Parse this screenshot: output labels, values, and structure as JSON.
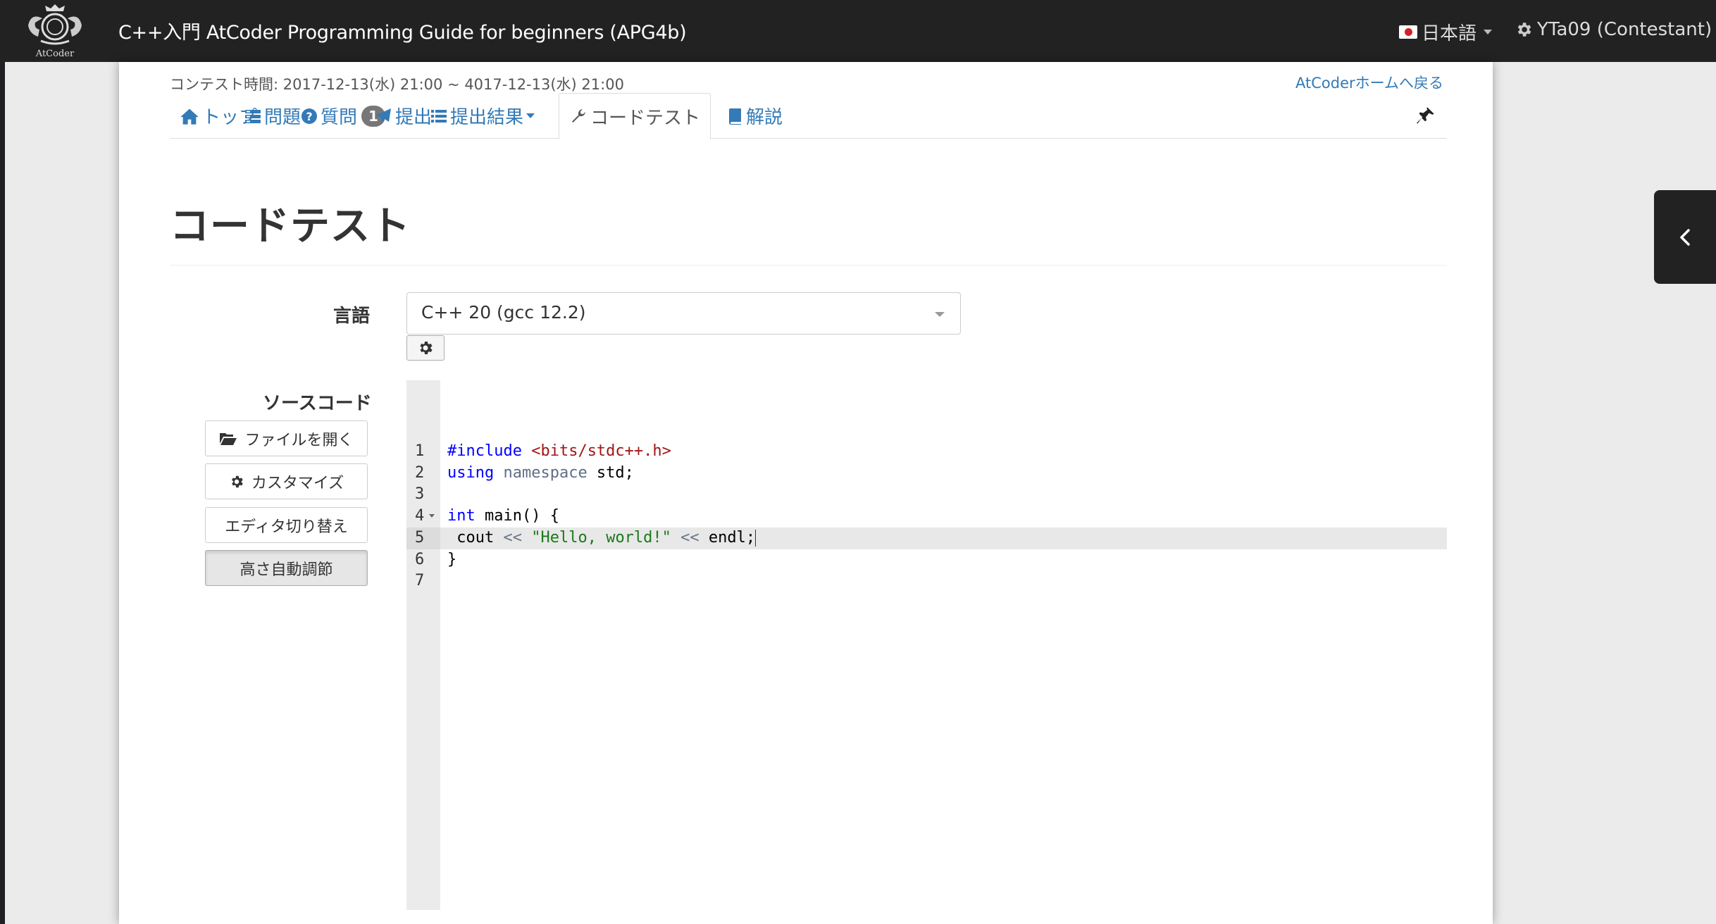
{
  "navbar": {
    "brand": "C++入門 AtCoder Programming Guide for beginners (APG4b)",
    "logo_text": "AtCoder",
    "language": "日本語",
    "user": "YTa09 (Contestant)"
  },
  "contest": {
    "time": "コンテスト時間: 2017-12-13(水) 21:00 ~ 4017-12-13(水) 21:00",
    "home_link": "AtCoderホームへ戻る"
  },
  "tabs": [
    {
      "label": "トップ",
      "icon": "home-icon"
    },
    {
      "label": "問題",
      "icon": "tasks-icon"
    },
    {
      "label": "質問",
      "icon": "question-circle-icon",
      "badge": "1"
    },
    {
      "label": "提出",
      "icon": "send-icon"
    },
    {
      "label": "提出結果",
      "icon": "list-icon"
    },
    {
      "label": "コードテスト",
      "icon": "wrench-icon",
      "active": true
    },
    {
      "label": "解説",
      "icon": "book-icon"
    }
  ],
  "page": {
    "title": "コードテスト",
    "language_label": "言語",
    "language_value": "C++ 20 (gcc 12.2)",
    "source_label": "ソースコード"
  },
  "buttons": {
    "open_file": "ファイルを開く",
    "customize": "カスタマイズ",
    "toggle_editor": "エディタ切り替え",
    "auto_height": "高さ自動調節"
  },
  "editor": {
    "line_numbers": [
      "1",
      "2",
      "3",
      "4",
      "5",
      "6",
      "7"
    ],
    "active_line": 5,
    "tokens": {
      "l1_a": "#include ",
      "l1_b": "<bits/stdc++.h>",
      "l2_a": "using",
      "l2_b": " namespace",
      "l2_c": " std;",
      "l4_a": "int",
      "l4_b": " main() {",
      "l5_a": " cout ",
      "l5_b": "<<",
      "l5_c": " ",
      "l5_d": "\"Hello, world!\"",
      "l5_e": " ",
      "l5_f": "<<",
      "l5_g": " endl;",
      "l6_a": "}"
    }
  },
  "colors": {
    "navbar_bg": "#222222",
    "link": "#337ab7",
    "keyword": "#0000ff",
    "string": "#1a7a1a",
    "header": "#a31515"
  }
}
